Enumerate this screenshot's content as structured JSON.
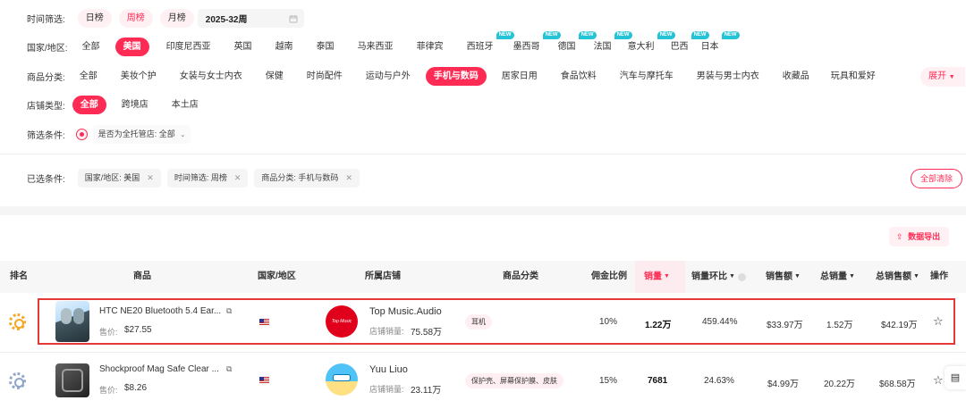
{
  "filters": {
    "time": {
      "label": "时间筛选:",
      "options": [
        "日榜",
        "周榜",
        "月榜"
      ],
      "active": "周榜",
      "date_value": "2025-32周"
    },
    "country": {
      "label": "国家/地区:",
      "options": [
        "全部",
        "美国",
        "印度尼西亚",
        "英国",
        "越南",
        "泰国",
        "马来西亚",
        "菲律宾",
        "西班牙",
        "墨西哥",
        "德国",
        "法国",
        "意大利",
        "巴西",
        "日本"
      ],
      "active": "美国",
      "new_badge": "NEW"
    },
    "category": {
      "label": "商品分类:",
      "options": [
        "全部",
        "美妆个护",
        "女装与女士内衣",
        "保健",
        "时尚配件",
        "运动与户外",
        "手机与数码",
        "居家日用",
        "食品饮料",
        "汽车与摩托车",
        "男装与男士内衣",
        "收藏品",
        "玩具和爱好"
      ],
      "active": "手机与数码",
      "expand_label": "展开"
    },
    "store_type": {
      "label": "店铺类型:",
      "options": [
        "全部",
        "跨境店",
        "本土店"
      ],
      "active": "全部"
    },
    "conditions": {
      "label": "筛选条件:",
      "managed_label": "是否为全托管店: 全部"
    },
    "selected": {
      "label": "已选条件:",
      "chips": [
        "国家/地区: 美国",
        "时间筛选: 周榜",
        "商品分类: 手机与数码"
      ],
      "clear_all": "全部清除"
    }
  },
  "export_label": "数据导出",
  "table": {
    "columns": {
      "rank": "排名",
      "product": "商品",
      "country": "国家/地区",
      "store": "所属店铺",
      "category": "商品分类",
      "commission": "佣金比例",
      "sales": "销量",
      "sales_ratio": "销量环比",
      "revenue": "销售额",
      "total_sales": "总销量",
      "total_revenue": "总销售额",
      "action": "操作"
    },
    "price_prefix": "售价:",
    "store_sales_prefix": "店铺销量:",
    "rows": [
      {
        "name": "HTC NE20 Bluetooth 5.4 Ear...",
        "price": "$27.55",
        "store": "Top Music.Audio",
        "store_logo_text": "Top Music",
        "store_sales": "75.58万",
        "category": "耳机",
        "commission": "10%",
        "sales": "1.22万",
        "sales_ratio": "459.44%",
        "revenue": "$33.97万",
        "total_sales": "1.52万",
        "total_revenue": "$42.19万",
        "rank_color": "#f5a623"
      },
      {
        "name": "Shockproof Mag Safe Clear ...",
        "price": "$8.26",
        "store": "Yuu Liuo",
        "store_sales": "23.11万",
        "category": "保护壳、屏幕保护膜、皮肤",
        "commission": "15%",
        "sales": "7681",
        "sales_ratio": "24.63%",
        "revenue": "$4.99万",
        "total_sales": "20.22万",
        "total_revenue": "$68.58万",
        "rank_color": "#8fa6c8"
      }
    ]
  },
  "colors": {
    "accent": "#fe2c55",
    "highlight": "#e53935",
    "new_badge": "#24c3d6"
  }
}
